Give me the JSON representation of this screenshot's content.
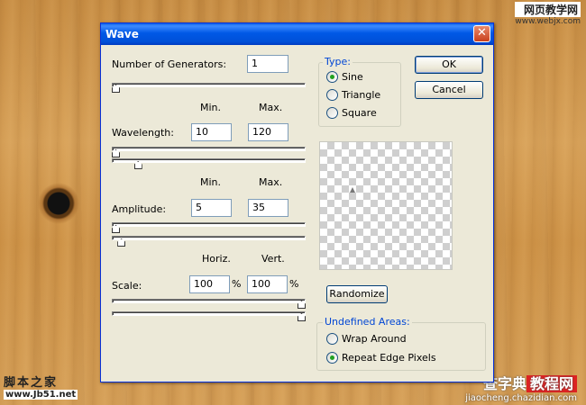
{
  "watermarks": {
    "top_right": {
      "line1": "网页教学网",
      "line2": "www.webjx.com"
    },
    "bottom_left": {
      "line1": "脚本之家",
      "line2": "www.Jb51.net"
    },
    "bottom_right": {
      "line1": "查字典",
      "line1_highlight": "教程网",
      "line2": "jiaocheng.chazidian.com"
    }
  },
  "dialog": {
    "title": "Wave",
    "close_symbol": "✕",
    "generators": {
      "label": "Number of Generators:",
      "value": "1",
      "slider_level": 0.0
    },
    "minmax_labels": {
      "min": "Min.",
      "max": "Max."
    },
    "wavelength": {
      "label": "Wavelength:",
      "min": "10",
      "max": "120",
      "min_slider_level": 0.0,
      "max_slider_level": 0.12
    },
    "amplitude": {
      "label": "Amplitude:",
      "min": "5",
      "max": "35",
      "min_slider_level": 0.0,
      "max_slider_level": 0.03
    },
    "scale_labels": {
      "horiz": "Horiz.",
      "vert": "Vert."
    },
    "scale": {
      "label": "Scale:",
      "horiz": "100",
      "vert": "100",
      "unit": "%",
      "horiz_slider_level": 1.0,
      "vert_slider_level": 1.0
    },
    "type": {
      "legend": "Type:",
      "options": [
        {
          "label": "Sine",
          "selected": true
        },
        {
          "label": "Triangle",
          "selected": false
        },
        {
          "label": "Square",
          "selected": false
        }
      ]
    },
    "ok_label": "OK",
    "cancel_label": "Cancel",
    "randomize_label": "Randomize",
    "undefined_areas": {
      "legend": "Undefined Areas:",
      "options": [
        {
          "label": "Wrap Around",
          "selected": false
        },
        {
          "label": "Repeat Edge Pixels",
          "selected": true
        }
      ]
    }
  },
  "colors": {
    "title_bar": "#0058e6",
    "group_legend": "#0046d5",
    "dialog_bg": "#ece9d8"
  }
}
